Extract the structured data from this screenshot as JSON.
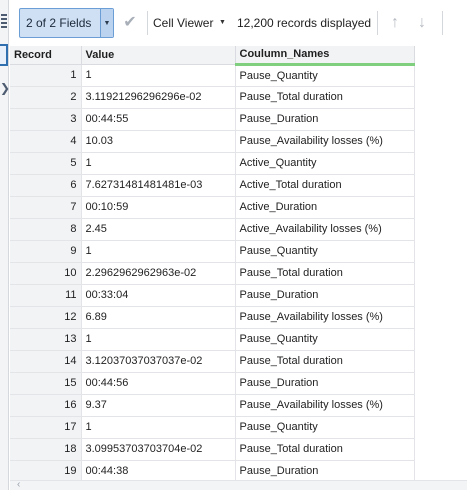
{
  "toolbar": {
    "fields_label": "2 of 2 Fields",
    "viewer_label": "Cell Viewer",
    "records_text": "12,200 records displayed",
    "icons": {
      "fields_dropdown": "chevron-down-icon",
      "apply": "check-icon",
      "viewer_dropdown": "caret-down-icon",
      "up": "arrow-up-icon",
      "down": "arrow-down-icon"
    }
  },
  "grid": {
    "headers": [
      "Record",
      "Value",
      "Coulumn_Names"
    ],
    "rows": [
      {
        "record": "1",
        "value": "1",
        "name": "Pause_Quantity"
      },
      {
        "record": "2",
        "value": "3.11921296296296e-02",
        "name": "Pause_Total duration"
      },
      {
        "record": "3",
        "value": "00:44:55",
        "name": "Pause_Duration"
      },
      {
        "record": "4",
        "value": "10.03",
        "name": "Pause_Availability losses (%)"
      },
      {
        "record": "5",
        "value": "1",
        "name": "Active_Quantity"
      },
      {
        "record": "6",
        "value": "7.62731481481481e-03",
        "name": "Active_Total duration"
      },
      {
        "record": "7",
        "value": "00:10:59",
        "name": "Active_Duration"
      },
      {
        "record": "8",
        "value": "2.45",
        "name": "Active_Availability losses (%)"
      },
      {
        "record": "9",
        "value": "1",
        "name": "Pause_Quantity"
      },
      {
        "record": "10",
        "value": "2.2962962962963e-02",
        "name": "Pause_Total duration"
      },
      {
        "record": "11",
        "value": "00:33:04",
        "name": "Pause_Duration"
      },
      {
        "record": "12",
        "value": "6.89",
        "name": "Pause_Availability losses (%)"
      },
      {
        "record": "13",
        "value": "1",
        "name": "Pause_Quantity"
      },
      {
        "record": "14",
        "value": "3.12037037037037e-02",
        "name": "Pause_Total duration"
      },
      {
        "record": "15",
        "value": "00:44:56",
        "name": "Pause_Duration"
      },
      {
        "record": "16",
        "value": "9.37",
        "name": "Pause_Availability losses (%)"
      },
      {
        "record": "17",
        "value": "1",
        "name": "Pause_Quantity"
      },
      {
        "record": "18",
        "value": "3.09953703703704e-02",
        "name": "Pause_Total duration"
      },
      {
        "record": "19",
        "value": "00:44:38",
        "name": "Pause_Duration"
      }
    ]
  },
  "colors": {
    "selected_button": "#cfe0f5",
    "header_bg": "#f2f3f5",
    "column_highlight": "#7fcf7f"
  }
}
